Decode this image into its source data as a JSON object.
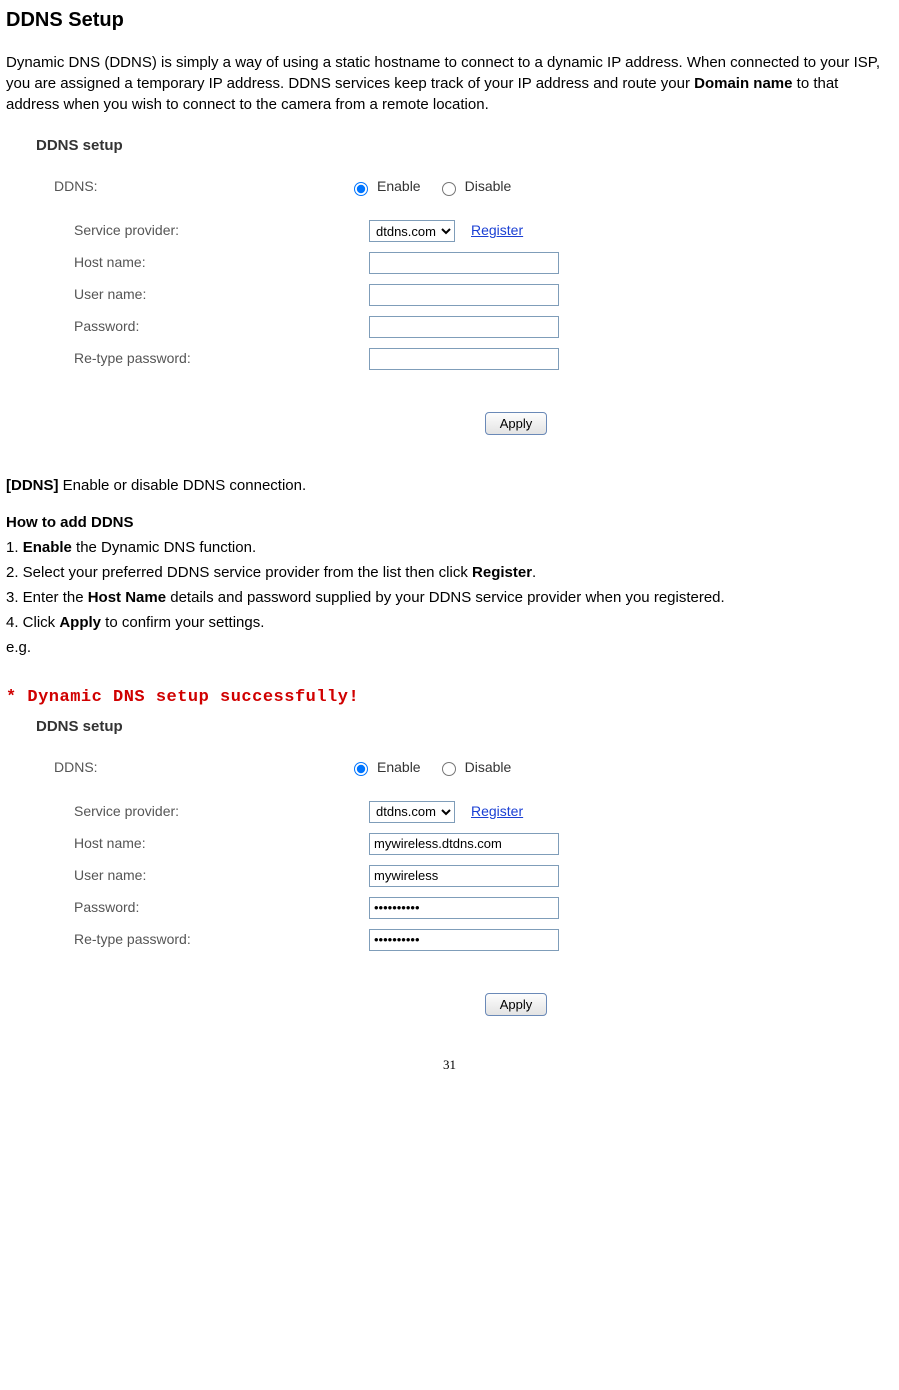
{
  "page": {
    "heading": "DDNS Setup",
    "intro_a": "Dynamic DNS (DDNS) is simply a way of using a static hostname to connect to a dynamic IP address. When connected to your ISP, you are assigned a temporary IP address. DDNS services keep track of your IP address and route your ",
    "intro_bold": "Domain name",
    "intro_b": " to that address when you wish to connect to the camera from a remote location."
  },
  "panel1": {
    "title": "DDNS setup",
    "labels": {
      "ddns": "DDNS:",
      "provider": "Service provider:",
      "host": "Host name:",
      "user": "User name:",
      "pwd": "Password:",
      "repwd": "Re-type password:"
    },
    "enable": "Enable",
    "disable": "Disable",
    "provider_value": "dtdns.com",
    "register": "Register",
    "host_value": "",
    "user_value": "",
    "pwd_value": "",
    "repwd_value": "",
    "apply": "Apply"
  },
  "desc": {
    "ddns_label": "[DDNS]",
    "ddns_text": " Enable or disable DDNS connection.",
    "howto_heading": "How to add DDNS",
    "step1_a": "1. ",
    "step1_b": "Enable",
    "step1_c": " the Dynamic DNS function.",
    "step2_a": "2. Select your preferred DDNS service provider from the list then click ",
    "step2_b": "Register",
    "step2_c": ".",
    "step3_a": "3. Enter the ",
    "step3_b": "Host Name",
    "step3_c": " details and password supplied by your DDNS service provider when you registered.",
    "step4_a": "4. Click ",
    "step4_b": "Apply",
    "step4_c": " to confirm your settings.",
    "eg": "e.g."
  },
  "success": "* Dynamic DNS setup successfully!",
  "panel2": {
    "title": "DDNS setup",
    "labels": {
      "ddns": "DDNS:",
      "provider": "Service provider:",
      "host": "Host name:",
      "user": "User name:",
      "pwd": "Password:",
      "repwd": "Re-type password:"
    },
    "enable": "Enable",
    "disable": "Disable",
    "provider_value": "dtdns.com",
    "register": "Register",
    "host_value": "mywireless.dtdns.com",
    "user_value": "mywireless",
    "pwd_value": "••••••••••",
    "repwd_value": "••••••••••",
    "apply": "Apply"
  },
  "footer": {
    "page_number": "31"
  }
}
